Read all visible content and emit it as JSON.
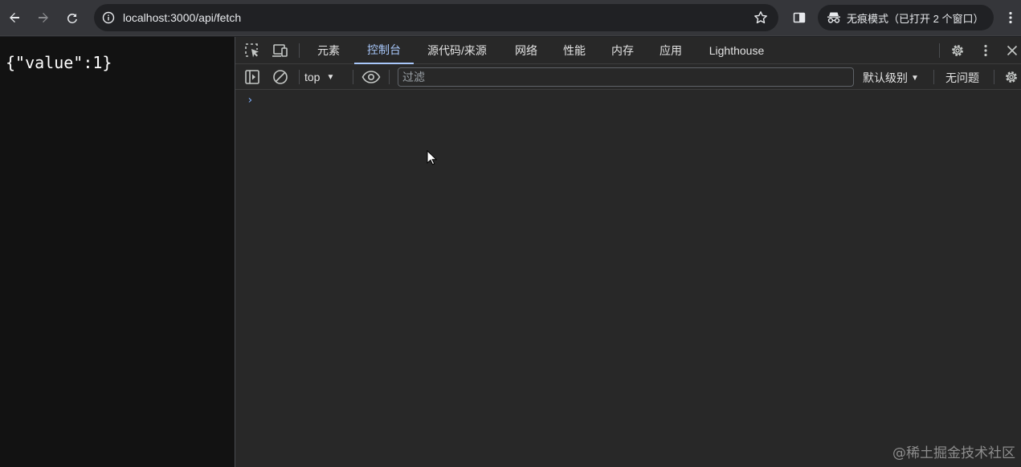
{
  "browser": {
    "url": "localhost:3000/api/fetch",
    "incognito_label": "无痕模式（已打开 2 个窗口）",
    "icons": {
      "back": "arrow-left-icon",
      "forward": "arrow-right-icon",
      "reload": "reload-icon",
      "site_info": "info-circle-icon",
      "bookmark": "star-icon",
      "side_panel": "side-panel-icon",
      "incognito": "incognito-icon",
      "menu": "kebab-menu-icon"
    }
  },
  "page": {
    "content": "{\"value\":1}"
  },
  "devtools": {
    "tabs": [
      {
        "label": "元素"
      },
      {
        "label": "控制台"
      },
      {
        "label": "源代码/来源"
      },
      {
        "label": "网络"
      },
      {
        "label": "性能"
      },
      {
        "label": "内存"
      },
      {
        "label": "应用"
      },
      {
        "label": "Lighthouse"
      }
    ],
    "active_tab": "控制台",
    "toolbar": {
      "context": "top",
      "filter_placeholder": "过滤",
      "level": "默认级别",
      "issues": "无问题"
    },
    "console": {
      "prompt": "›"
    }
  },
  "watermark": "@稀土掘金技术社区",
  "colors": {
    "accent": "#a8c7fa",
    "devtools_bg": "#282828",
    "page_bg": "#121212",
    "chrome_bg": "#35363a"
  }
}
